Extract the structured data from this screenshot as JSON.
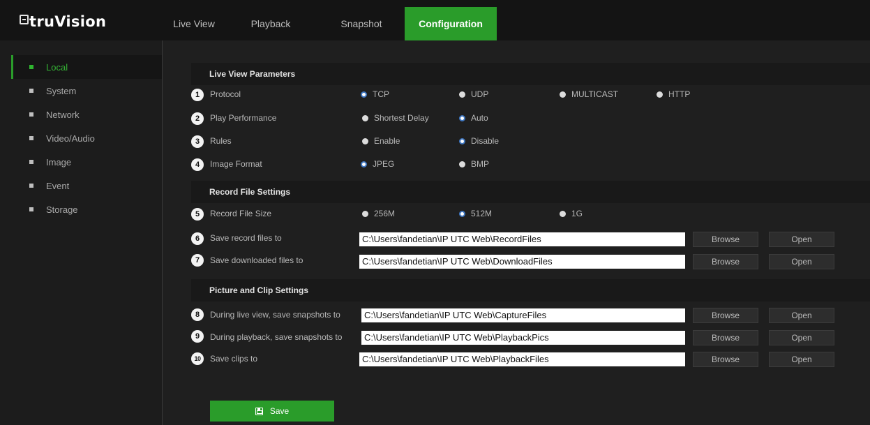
{
  "app": {
    "logo_text": "truVision",
    "nav_tabs": [
      "Live View",
      "Playback",
      "Snapshot",
      "Configuration"
    ],
    "active_tab": "Configuration"
  },
  "sidebar": {
    "items": [
      "Local",
      "System",
      "Network",
      "Video/Audio",
      "Image",
      "Event",
      "Storage"
    ],
    "active": "Local"
  },
  "sections": {
    "live_view": "Live View Parameters",
    "record_file": "Record File Settings",
    "picture_clip": "Picture and Clip Settings"
  },
  "rows": {
    "protocol": {
      "badge": "1",
      "label": "Protocol",
      "options": [
        "TCP",
        "UDP",
        "MULTICAST",
        "HTTP"
      ],
      "selected": "TCP"
    },
    "play_performance": {
      "badge": "2",
      "label": "Play Performance",
      "options": [
        "Shortest Delay",
        "Auto"
      ],
      "selected": "Auto"
    },
    "rules": {
      "badge": "3",
      "label": "Rules",
      "options": [
        "Enable",
        "Disable"
      ],
      "selected": "Disable"
    },
    "image_format": {
      "badge": "4",
      "label": "Image Format",
      "options": [
        "JPEG",
        "BMP"
      ],
      "selected": "JPEG"
    },
    "record_file_size": {
      "badge": "5",
      "label": "Record File Size",
      "options": [
        "256M",
        "512M",
        "1G"
      ],
      "selected": "512M"
    },
    "save_record": {
      "badge": "6",
      "label": "Save record files to",
      "value": "C:\\Users\\fandetian\\IP UTC Web\\RecordFiles"
    },
    "save_downloaded": {
      "badge": "7",
      "label": "Save downloaded files to",
      "value": "C:\\Users\\fandetian\\IP UTC Web\\DownloadFiles"
    },
    "live_snapshots": {
      "badge": "8",
      "label": "During live view, save snapshots to",
      "value": "C:\\Users\\fandetian\\IP UTC Web\\CaptureFiles"
    },
    "playback_snapshots": {
      "badge": "9",
      "label": "During playback, save snapshots to",
      "value": "C:\\Users\\fandetian\\IP UTC Web\\PlaybackPics"
    },
    "save_clips": {
      "badge": "10",
      "label": "Save clips to",
      "value": "C:\\Users\\fandetian\\IP UTC Web\\PlaybackFiles"
    }
  },
  "buttons": {
    "browse": "Browse",
    "open": "Open",
    "save": "Save"
  },
  "colors": {
    "accent_green": "#2a9c2a",
    "radio_selected_ring": "#3f77c2",
    "background": "#1f1f1f"
  }
}
